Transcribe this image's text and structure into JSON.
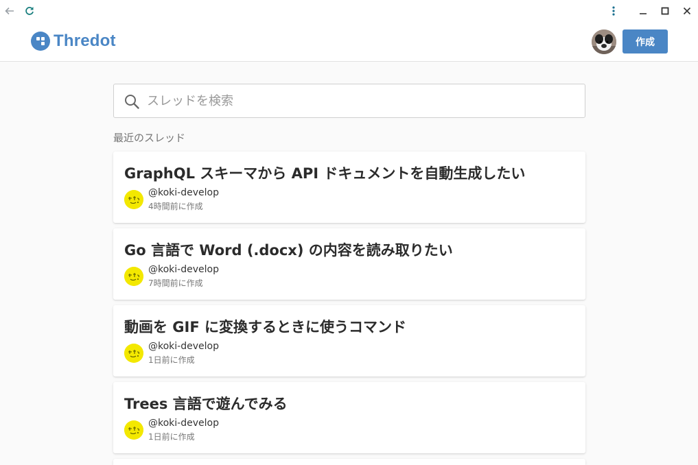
{
  "app": {
    "name": "Thredot",
    "create_label": "作成",
    "user_avatar_icon": "user-avatar-dog",
    "brand_color": "#4a86c5"
  },
  "window": {
    "back_icon": "arrow-left-icon",
    "reload_icon": "reload-icon",
    "menu_icon": "kebab-menu-icon",
    "minimize_icon": "minimize-icon",
    "maximize_icon": "maximize-icon",
    "close_icon": "close-icon"
  },
  "search": {
    "placeholder": "スレッドを検索",
    "value": ""
  },
  "recent": {
    "title": "最近のスレッド",
    "threads": [
      {
        "title": "GraphQL スキーマから API ドキュメントを自動生成したい",
        "author": "@koki-develop",
        "created": "4時間前に作成"
      },
      {
        "title": "Go 言語で Word (.docx) の内容を読み取りたい",
        "author": "@koki-develop",
        "created": "7時間前に作成"
      },
      {
        "title": "動画を GIF に変換するときに使うコマンド",
        "author": "@koki-develop",
        "created": "1日前に作成"
      },
      {
        "title": "Trees 言語で遊んでみる",
        "author": "@koki-develop",
        "created": "1日前に作成"
      }
    ]
  }
}
